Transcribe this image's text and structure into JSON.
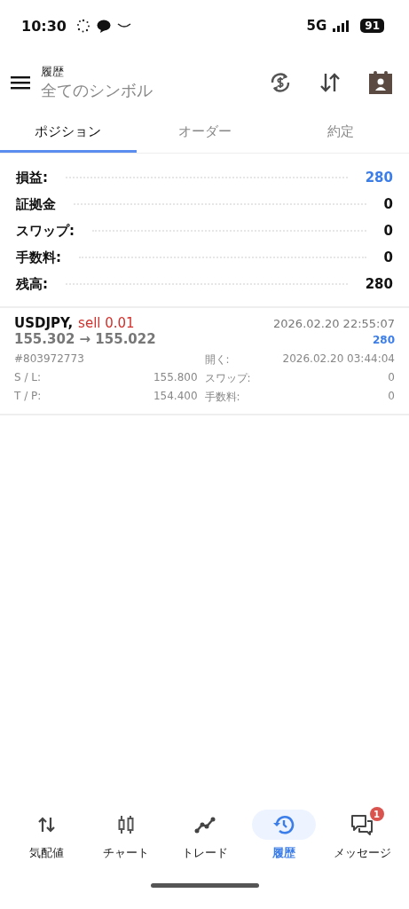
{
  "status_bar": {
    "time": "10:30",
    "network": "5G",
    "battery": "91"
  },
  "header": {
    "title": "履歴",
    "subtitle": "全てのシンボル"
  },
  "tabs": [
    {
      "label": "ポジション",
      "selected": true
    },
    {
      "label": "オーダー",
      "selected": false
    },
    {
      "label": "約定",
      "selected": false
    }
  ],
  "summary": [
    {
      "label": "損益:",
      "value": "280",
      "emphasis": true
    },
    {
      "label": "証拠金",
      "value": "0",
      "emphasis": false
    },
    {
      "label": "スワップ:",
      "value": "0",
      "emphasis": false
    },
    {
      "label": "手数料:",
      "value": "0",
      "emphasis": false
    },
    {
      "label": "残高:",
      "value": "280",
      "emphasis": false
    }
  ],
  "deals": [
    {
      "symbol": "USDJPY,",
      "side": "sell 0.01",
      "prices": "155.302 → 155.022",
      "time": "2026.02.20 22:55:07",
      "profit": "280",
      "ticket": "#803972773",
      "open_label": "開く:",
      "open_time": "2026.02.20 03:44:04",
      "sl_label": "S / L:",
      "sl": "155.800",
      "swap_label": "スワップ:",
      "swap": "0",
      "tp_label": "T / P:",
      "tp": "154.400",
      "fee_label": "手数料:",
      "fee": "0"
    }
  ],
  "bottom_nav": [
    {
      "kind": "quotes",
      "label": "気配値",
      "selected": false
    },
    {
      "kind": "chart",
      "label": "チャート",
      "selected": false
    },
    {
      "kind": "trade",
      "label": "トレード",
      "selected": false
    },
    {
      "kind": "history",
      "label": "履歴",
      "selected": true
    },
    {
      "kind": "messages",
      "label": "メッセージ",
      "selected": false,
      "badge": "1"
    }
  ]
}
